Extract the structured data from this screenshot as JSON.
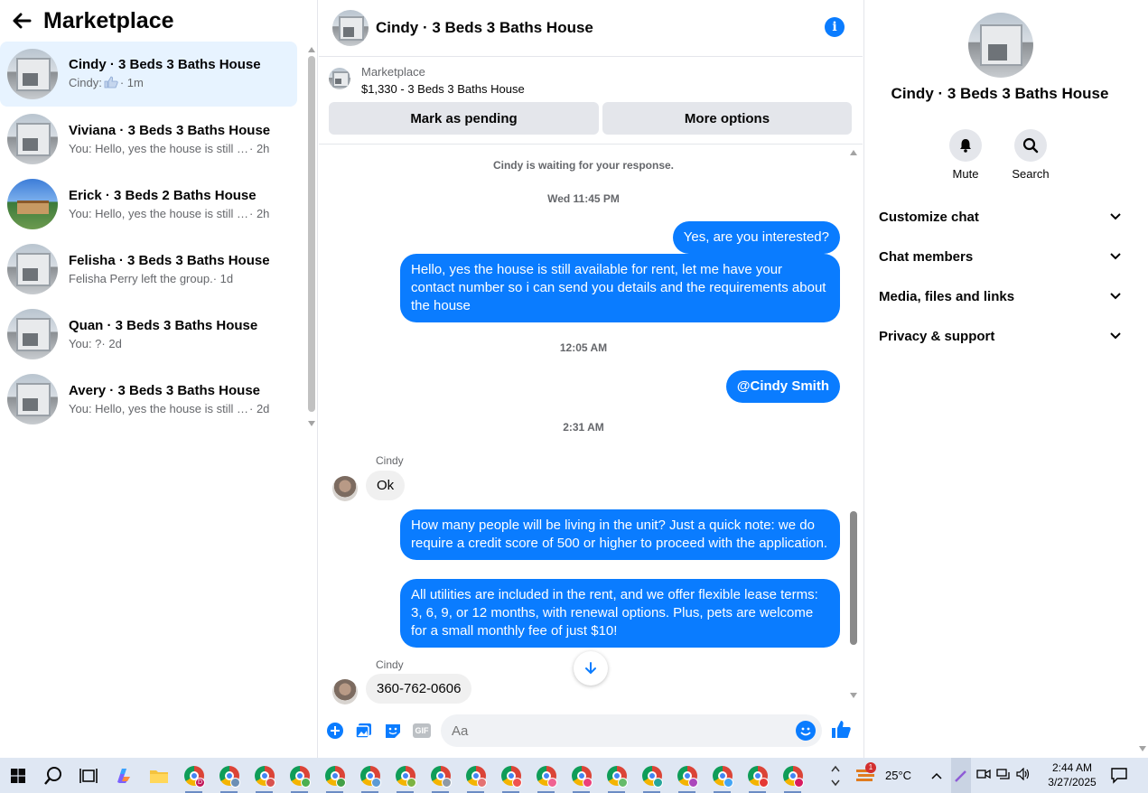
{
  "left": {
    "title": "Marketplace",
    "conversations": [
      {
        "name": "Cindy · 3 Beds 3 Baths House",
        "snippet": "Cindy: ",
        "time": "· 1m",
        "thumb": "house-icon"
      },
      {
        "name": "Viviana · 3 Beds 3 Baths House",
        "snippet": "You: Hello, yes the house is still avai...",
        "time": " · 2h",
        "thumb": "house-icon"
      },
      {
        "name": "Erick · 3 Beds 2 Baths House",
        "snippet": "You: Hello, yes the house is still avai...",
        "time": " · 2h",
        "thumb": "house-blue-icon"
      },
      {
        "name": "Felisha · 3 Beds 3 Baths House",
        "snippet": "Felisha Perry left the group.",
        "time": " · 1d",
        "thumb": "house-icon"
      },
      {
        "name": "Quan · 3 Beds 3 Baths House",
        "snippet": "You: ?",
        "time": " · 2d",
        "thumb": "house-icon"
      },
      {
        "name": "Avery · 3 Beds 3 Baths House",
        "snippet": "You: Hello, yes the house is still avai...",
        "time": " · 2d",
        "thumb": "house-icon"
      }
    ]
  },
  "chat": {
    "title": "Cindy · 3 Beds 3 Baths House",
    "listing_label": "Marketplace",
    "listing_price": "$1,330 - 3 Beds 3 Baths House",
    "mark_pending": "Mark as pending",
    "more_options": "More options",
    "waiting": "Cindy is waiting for your response.",
    "ts1": "Wed 11:45 PM",
    "msg1": "Yes, are you interested?",
    "msg2": "Hello, yes the house is still available for rent, let me have your contact number so i can send you details and the requirements about the house",
    "ts2": "12:05 AM",
    "msg3": "@Cindy Smith",
    "ts3": "2:31 AM",
    "sender": "Cindy",
    "msg4": "Ok",
    "msg5": "How many people will be living in the unit? Just a quick note: we do require a credit score of 500 or higher to proceed with the application.",
    "msg6": "All utilities are included in the rent, and we offer flexible lease terms: 3, 6, 9, or 12 months, with renewal options. Plus, pets are welcome for a small monthly fee of just $10!",
    "msg7": "360-762-0606",
    "input_placeholder": "Aa",
    "gif_label": "GIF"
  },
  "right": {
    "title": "Cindy · 3 Beds 3 Baths House",
    "mute": "Mute",
    "search": "Search",
    "sections": [
      "Customize chat",
      "Chat members",
      "Media, files and links",
      "Privacy & support"
    ]
  },
  "taskbar": {
    "temperature": "25°C",
    "time": "2:44 AM",
    "date": "3/27/2025",
    "weather_badge": "1",
    "app_badge": "D"
  },
  "colors": {
    "accent": "#0a7cff",
    "active_conv": "#e7f3ff",
    "taskbar": "#dfe7f3"
  }
}
